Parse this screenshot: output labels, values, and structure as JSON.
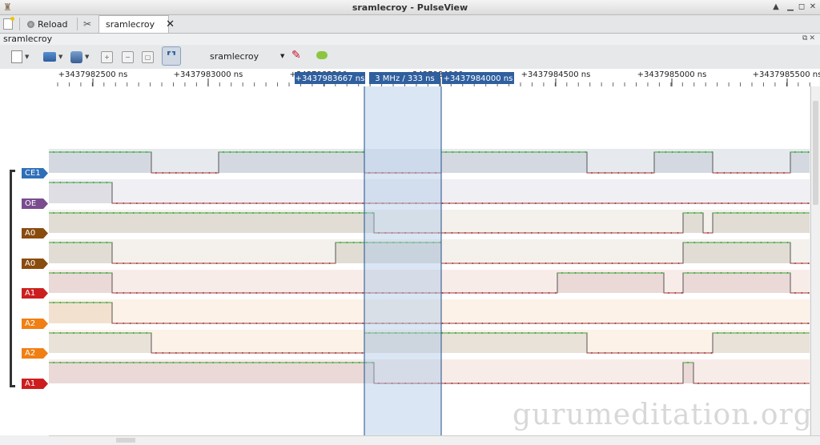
{
  "window": {
    "title": "sramlecroy - PulseView"
  },
  "tabbar": {
    "reload_label": "Reload",
    "doc_tab_label": "sramlecroy"
  },
  "session": {
    "label": "sramlecroy"
  },
  "toolbar": {
    "device": "sramlecroy"
  },
  "ruler": {
    "ticks": [
      {
        "label": "+3437982500 ns"
      },
      {
        "label": "+3437983000 ns"
      },
      {
        "label": "+3437983500 ns"
      },
      {
        "label": "+3437984000 ns"
      },
      {
        "label": "+3437984500 ns"
      },
      {
        "label": "+3437985000 ns"
      },
      {
        "label": "+3437985500 ns"
      }
    ],
    "cursor_left": "+3437983667 ns",
    "cursor_mid": "3 MHz / 333 ns",
    "cursor_right": "+3437984000 ns"
  },
  "channels": [
    {
      "label": "CE1",
      "color": "#2f6fb8"
    },
    {
      "label": "OE",
      "color": "#7a4b8e"
    },
    {
      "label": "A0",
      "color": "#8a4b0f"
    },
    {
      "label": "A0",
      "color": "#8a4b0f"
    },
    {
      "label": "A1",
      "color": "#cc1e1e"
    },
    {
      "label": "A2",
      "color": "#f07f14"
    },
    {
      "label": "A2",
      "color": "#f07f14"
    },
    {
      "label": "A1",
      "color": "#cc1e1e"
    }
  ],
  "colors": {
    "high": "#3aa33a",
    "low": "#a33a3a",
    "cursor_region": "#dce6f2",
    "cursor_flag": "#2f5f9e"
  },
  "watermark": "gurumeditation.org"
}
